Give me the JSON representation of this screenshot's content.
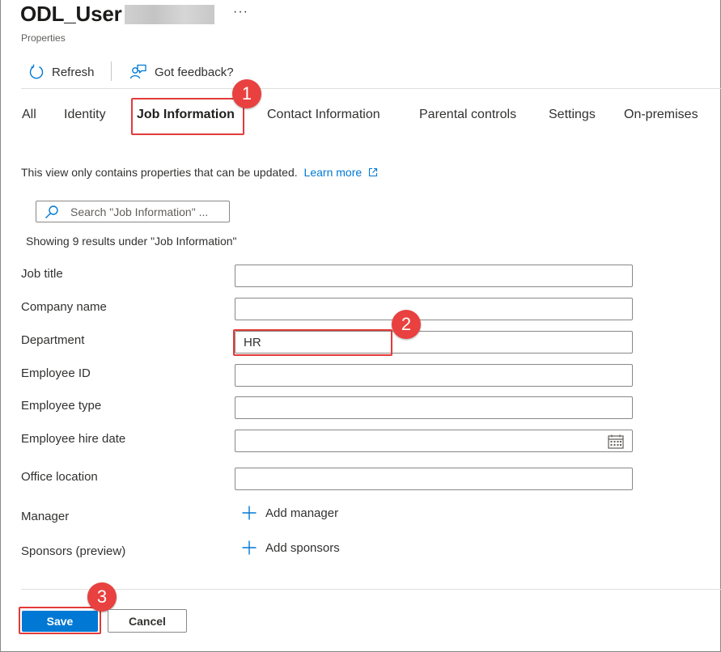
{
  "header": {
    "title": "ODL_User",
    "more": "···",
    "subtitle": "Properties"
  },
  "toolbar": {
    "refresh_label": "Refresh",
    "feedback_label": "Got feedback?"
  },
  "tabs": [
    {
      "label": "All"
    },
    {
      "label": "Identity"
    },
    {
      "label": "Job Information",
      "active": true
    },
    {
      "label": "Contact Information"
    },
    {
      "label": "Parental controls"
    },
    {
      "label": "Settings"
    },
    {
      "label": "On-premises"
    }
  ],
  "info": {
    "text": "This view only contains properties that can be updated.",
    "link": "Learn more"
  },
  "search": {
    "placeholder": "Search \"Job Information\" ..."
  },
  "results_text": "Showing 9 results under \"Job Information\"",
  "fields": [
    {
      "label": "Job title",
      "value": ""
    },
    {
      "label": "Company name",
      "value": ""
    },
    {
      "label": "Department",
      "value": "HR"
    },
    {
      "label": "Employee ID",
      "value": ""
    },
    {
      "label": "Employee type",
      "value": ""
    },
    {
      "label": "Employee hire date",
      "value": ""
    },
    {
      "label": "Office location",
      "value": ""
    }
  ],
  "manager": {
    "label": "Manager",
    "action": "Add manager"
  },
  "sponsors": {
    "label": "Sponsors (preview)",
    "action": "Add sponsors"
  },
  "footer": {
    "save_label": "Save",
    "cancel_label": "Cancel"
  },
  "callouts": [
    "1",
    "2",
    "3"
  ],
  "colors": {
    "accent": "#0078d4",
    "callout": "#e8413f",
    "highlight": "#e23a3a"
  }
}
